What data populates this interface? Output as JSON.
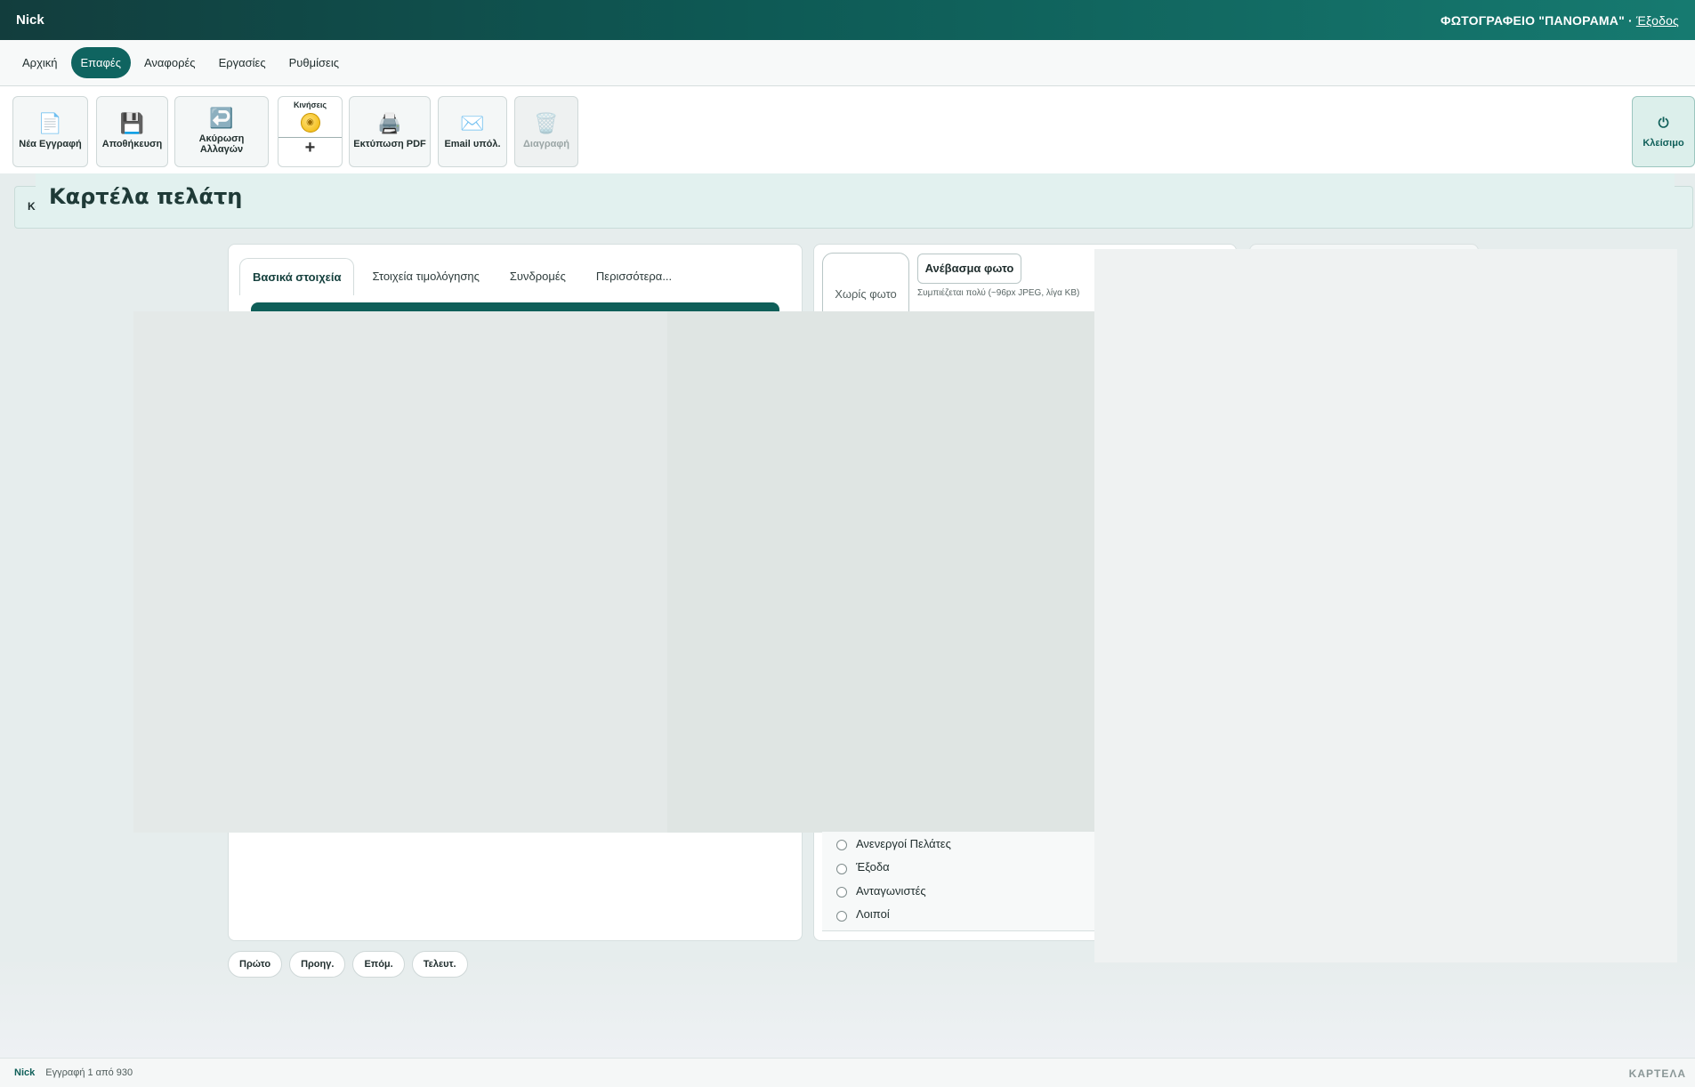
{
  "topbar": {
    "user": "Nick",
    "company": "ΦΩΤΟΓΡΑΦΕΙΟ \"ΠΑΝΟΡΑΜΑ\"",
    "separator": "·",
    "logout": "Έξοδος"
  },
  "nav": {
    "items": [
      {
        "label": "Αρχική"
      },
      {
        "label": "Επαφές"
      },
      {
        "label": "Αναφορές"
      },
      {
        "label": "Εργασίες"
      },
      {
        "label": "Ρυθμίσεις"
      }
    ],
    "active_index": 1
  },
  "toolbar": {
    "new_label": "Νέα Εγγραφή",
    "save_label": "Αποθήκευση",
    "cancel_label": "Ακύρωση Αλλαγών",
    "movements_label": "Κινήσεις",
    "movements_plus": "+",
    "print_label": "Εκτύπωση PDF",
    "email_label": "Email υπόλ.",
    "delete_label": "Διαγραφή",
    "close_label": "Κλείσιμο",
    "icons": {
      "new": "document-icon",
      "save": "floppy-disk-icon",
      "cancel": "undo-arrow-icon",
      "movements": "coin-icon",
      "print": "printer-icon",
      "email": "envelope-icon",
      "delete": "trash-icon",
      "close": "power-icon"
    }
  },
  "page": {
    "title": "Καρτέλα πελάτη",
    "title_bar_fragment": "Κα"
  },
  "tabs": [
    {
      "label": "Βασικά στοιχεία"
    },
    {
      "label": "Στοιχεία τιμολόγησης"
    },
    {
      "label": "Συνδρομές"
    },
    {
      "label": "Περισσότερα..."
    }
  ],
  "photo": {
    "no_photo": "Χωρίς φωτο",
    "upload_label": "Ανέβασμα φωτο",
    "hint": "Συμπιέζεται πολύ (~96px JPEG, λίγα KB)"
  },
  "categories": [
    {
      "label": "Ανενεργοί Πελάτες"
    },
    {
      "label": "Έξοδα"
    },
    {
      "label": "Ανταγωνιστές"
    },
    {
      "label": "Λοιποί"
    }
  ],
  "pager": {
    "first": "Πρώτο",
    "prev": "Προηγ.",
    "next": "Επόμ.",
    "last": "Τελευτ."
  },
  "status": {
    "user": "Nick",
    "record": "Εγγραφή 1 από 930",
    "mode": "ΚΑΡΤΕΛΑ"
  },
  "colors": {
    "accent": "#0f6460",
    "topbar_start": "#123d3d",
    "topbar_end": "#167a70"
  }
}
